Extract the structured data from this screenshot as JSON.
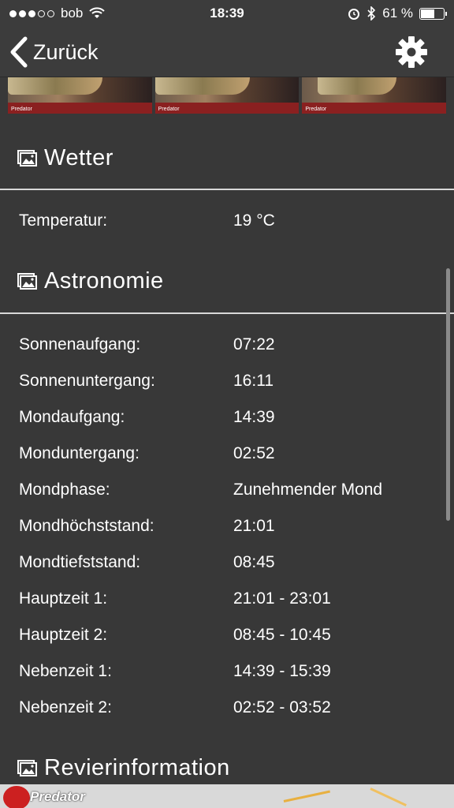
{
  "status_bar": {
    "carrier": "bob",
    "time": "18:39",
    "battery_text": "61 %",
    "battery_level": 0.61
  },
  "nav": {
    "back_label": "Zurück"
  },
  "photo_strip": {
    "badge": "Predator"
  },
  "weather": {
    "title": "Wetter",
    "rows": [
      {
        "label": "Temperatur:",
        "value": "19 °C"
      }
    ]
  },
  "astronomy": {
    "title": "Astronomie",
    "rows": [
      {
        "label": "Sonnenaufgang:",
        "value": "07:22"
      },
      {
        "label": "Sonnenuntergang:",
        "value": "16:11"
      },
      {
        "label": "Mondaufgang:",
        "value": "14:39"
      },
      {
        "label": "Monduntergang:",
        "value": "02:52"
      },
      {
        "label": "Mondphase:",
        "value": "Zunehmender Mond"
      },
      {
        "label": "Mondhöchststand:",
        "value": "21:01"
      },
      {
        "label": "Mondtiefststand:",
        "value": "08:45"
      },
      {
        "label": "Hauptzeit 1:",
        "value": "21:01 - 23:01"
      },
      {
        "label": "Hauptzeit 2:",
        "value": "08:45 - 10:45"
      },
      {
        "label": "Nebenzeit 1:",
        "value": "14:39 - 15:39"
      },
      {
        "label": "Nebenzeit 2:",
        "value": "02:52 - 03:52"
      }
    ]
  },
  "area_info": {
    "title": "Revierinformation"
  },
  "footer": {
    "brand": "Predator"
  },
  "colors": {
    "background": "#383838",
    "bar": "#3c3c3c",
    "divider": "#d8d8d8",
    "text": "#ffffff"
  }
}
